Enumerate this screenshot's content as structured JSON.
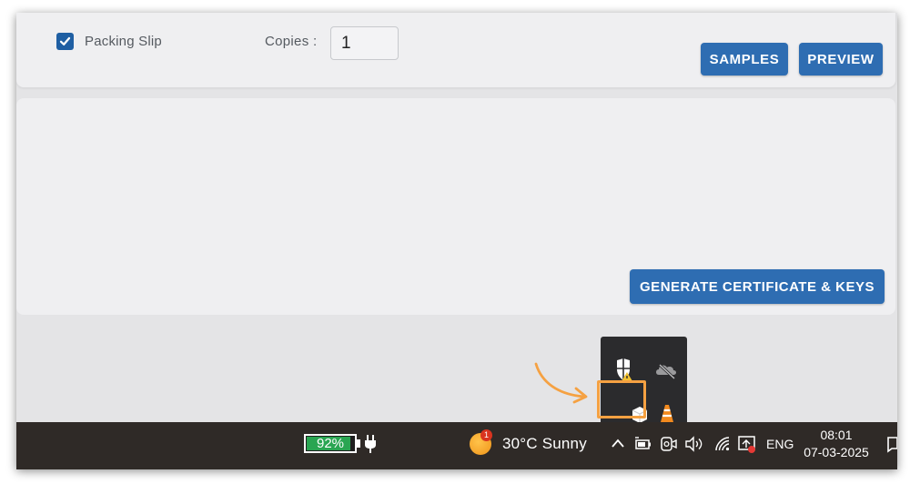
{
  "options": {
    "packing_slip": {
      "label": "Packing Slip",
      "checked": true
    },
    "copies_label": "Copies :",
    "copies_value": "1"
  },
  "buttons": {
    "samples": "SAMPLES",
    "preview": "PREVIEW",
    "generate": "GENERATE CERTIFICATE & KEYS"
  },
  "colors": {
    "primary_button": "#2e6db2",
    "highlight_box": "#f5a142",
    "taskbar": "#2f2a27",
    "battery_fill": "#2aa552"
  },
  "tray_overflow": {
    "icons": [
      "windows-security-warning-icon",
      "onedrive-offline-icon",
      "app-box-icon",
      "vlc-cone-icon"
    ],
    "highlighted_icon": "app-box-icon"
  },
  "taskbar": {
    "battery_percent": "92%",
    "battery_level": 0.92,
    "weather_badge": "1",
    "weather": "30°C  Sunny",
    "language": "ENG",
    "time": "08:01",
    "date": "07-03-2025"
  }
}
